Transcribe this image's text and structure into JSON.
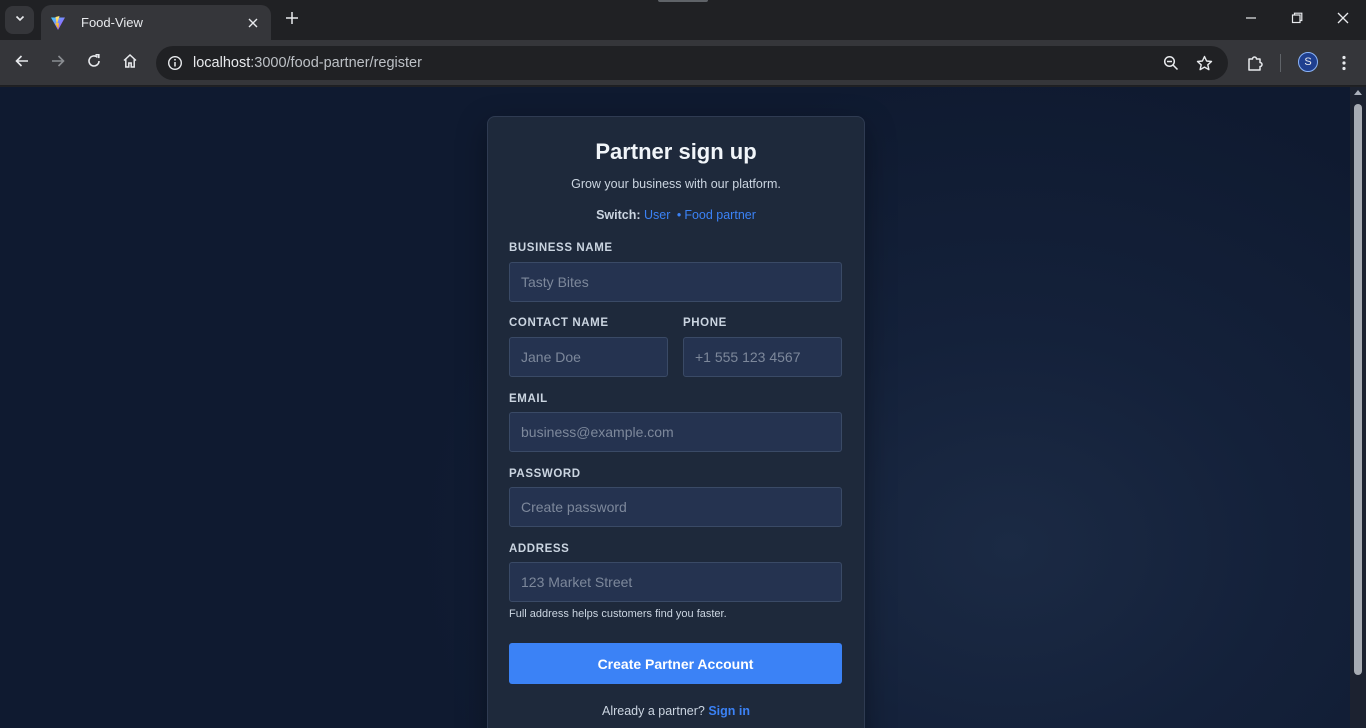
{
  "browser": {
    "tab_title": "Food-View",
    "url_host": "localhost",
    "url_rest": ":3000/food-partner/register",
    "profile_initial": "S"
  },
  "icons": {
    "tab_search": "chevron-down-icon",
    "favicon": "vite-logo-icon",
    "tab_close": "close-icon",
    "new_tab": "plus-icon",
    "minimize": "minimize-icon",
    "restore": "restore-icon",
    "close_window": "close-icon",
    "back": "arrow-left-icon",
    "forward": "arrow-right-icon",
    "reload": "reload-icon",
    "home": "home-icon",
    "site_info": "info-icon",
    "zoom": "zoom-out-icon",
    "bookmark": "star-icon",
    "extensions": "puzzle-icon",
    "menu": "kebab-menu-icon"
  },
  "form": {
    "title": "Partner sign up",
    "subtitle": "Grow your business with our platform.",
    "switch_label": "Switch:",
    "switch_user": "User",
    "switch_separator": "•",
    "switch_partner": "Food partner",
    "business_name_label": "BUSINESS NAME",
    "business_name_placeholder": "Tasty Bites",
    "contact_name_label": "CONTACT NAME",
    "contact_name_placeholder": "Jane Doe",
    "phone_label": "PHONE",
    "phone_placeholder": "+1 555 123 4567",
    "email_label": "EMAIL",
    "email_placeholder": "business@example.com",
    "password_label": "PASSWORD",
    "password_placeholder": "Create password",
    "address_label": "ADDRESS",
    "address_placeholder": "123 Market Street",
    "address_hint": "Full address helps customers find you faster.",
    "submit_label": "Create Partner Account",
    "footer_text": "Already a partner?",
    "signin_label": "Sign in"
  },
  "colors": {
    "accent": "#3b82f6",
    "card_bg": "#1e293b",
    "input_bg": "#253350",
    "page_bg": "#0f1a30"
  }
}
